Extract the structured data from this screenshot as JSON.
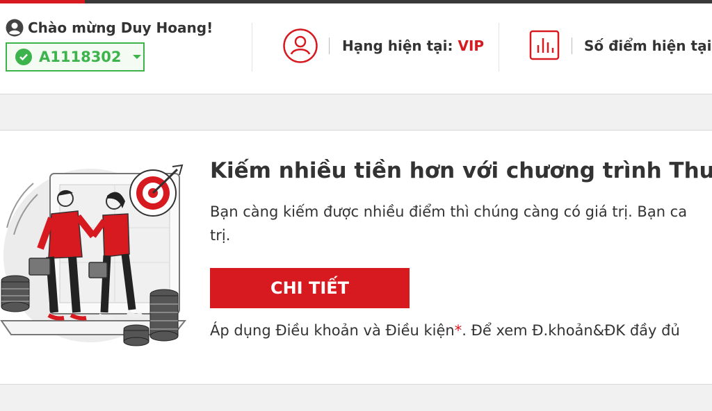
{
  "header": {
    "greeting": "Chào mừng Duy Hoang!",
    "account_number": "A1118302",
    "rank_label": "Hạng hiện tại: ",
    "rank_value": "VIP",
    "points_label": "Số điểm hiện tại: "
  },
  "promo": {
    "title": "Kiếm nhiều tiền hơn với chương trình Thư",
    "description": "Bạn càng kiếm được nhiều điểm thì chúng càng có giá trị. Bạn ca trị.",
    "button_label": "CHI TIẾT",
    "terms_before": "Áp dụng Điều khoản và Điều kiện",
    "terms_asterisk": "*",
    "terms_after": ". Để xem Đ.khoản&ĐK đầy đủ"
  },
  "colors": {
    "brand_red": "#d71920",
    "success_green": "#3cb44b",
    "text": "#333333"
  },
  "icons": [
    "user-icon",
    "check-icon",
    "chevron-down-icon",
    "user-circle-icon",
    "bar-chart-icon"
  ]
}
